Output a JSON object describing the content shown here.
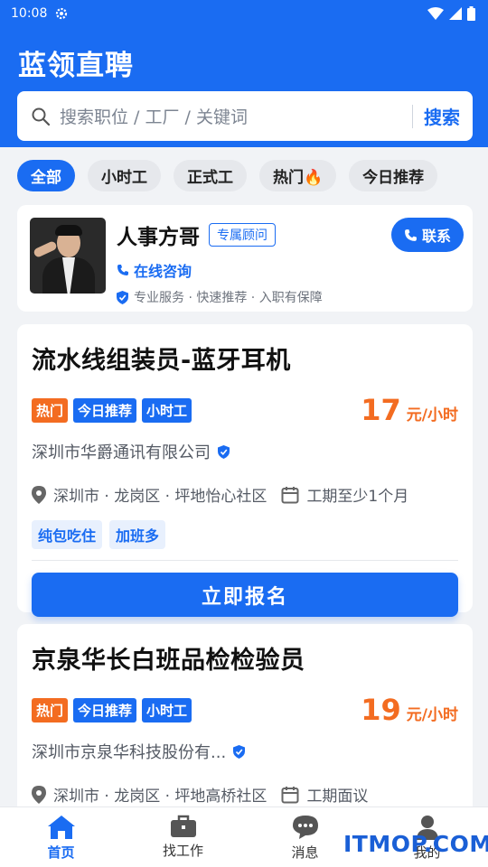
{
  "status_bar": {
    "time": "10:08"
  },
  "header": {
    "app_title": "蓝领直聘"
  },
  "search": {
    "placeholder": "搜索职位 / 工厂 / 关键词",
    "button_label": "搜索"
  },
  "filters": [
    {
      "label": "全部",
      "active": true
    },
    {
      "label": "小时工",
      "active": false
    },
    {
      "label": "正式工",
      "active": false
    },
    {
      "label": "热门🔥",
      "active": false
    },
    {
      "label": "今日推荐",
      "active": false
    }
  ],
  "consultant": {
    "name": "人事方哥",
    "badge": "专属顾问",
    "online": "在线咨询",
    "description": "专业服务 · 快速推荐 · 入职有保障",
    "contact_label": "联系"
  },
  "jobs": [
    {
      "title": "流水线组装员-蓝牙耳机",
      "tags": [
        "热门",
        "今日推荐",
        "小时工"
      ],
      "salary": "17",
      "salary_unit": "元/小时",
      "company": "深圳市华爵通讯有限公司",
      "location": "深圳市 · 龙岗区 · 坪地怡心社区",
      "period": "工期至少1个月",
      "benefits": [
        "纯包吃住",
        "加班多"
      ],
      "apply_label": "立即报名"
    },
    {
      "title": "京泉华长白班品检检验员",
      "tags": [
        "热门",
        "今日推荐",
        "小时工"
      ],
      "salary": "19",
      "salary_unit": "元/小时",
      "company": "深圳市京泉华科技股份有...",
      "location": "深圳市 · 龙岗区 · 坪地高桥社区",
      "period": "工期面议"
    }
  ],
  "tabbar": [
    {
      "label": "首页",
      "icon": "home-icon",
      "active": true
    },
    {
      "label": "找工作",
      "icon": "briefcase-icon",
      "active": false
    },
    {
      "label": "消息",
      "icon": "chat-icon",
      "active": false
    },
    {
      "label": "我的",
      "icon": "person-icon",
      "active": false
    }
  ],
  "watermark": "ITMOP.COM",
  "colors": {
    "primary": "#1a6cf2",
    "accent": "#f36c21",
    "background": "#f1f3f6"
  }
}
